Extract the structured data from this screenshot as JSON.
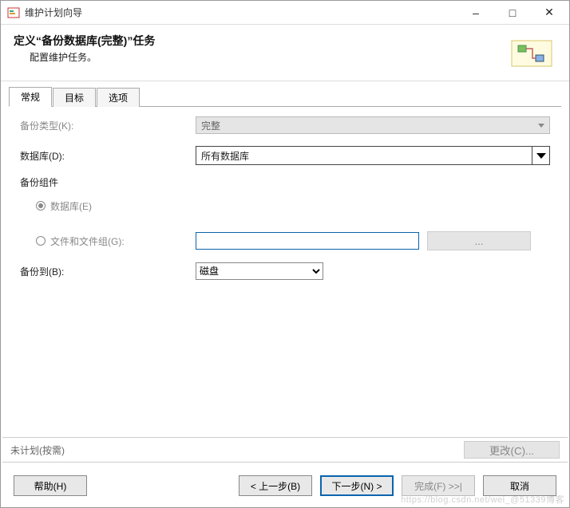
{
  "window": {
    "title": "维护计划向导"
  },
  "header": {
    "title": "定义“备份数据库(完整)”任务",
    "subtitle": "配置维护任务。"
  },
  "tabs": [
    {
      "label": "常规",
      "active": true
    },
    {
      "label": "目标",
      "active": false
    },
    {
      "label": "选项",
      "active": false
    }
  ],
  "form": {
    "backup_type_label": "备份类型(K):",
    "backup_type_value": "完整",
    "database_label": "数据库(D):",
    "database_value": "所有数据库",
    "component_label": "备份组件",
    "radio_database_label": "数据库(E)",
    "radio_filegroup_label": "文件和文件组(G):",
    "filegroup_value": "",
    "ellipsis_label": "...",
    "backup_to_label": "备份到(B):",
    "backup_to_value": "磁盘"
  },
  "bottom": {
    "schedule_text": "未计划(按需)",
    "change_label": "更改(C)..."
  },
  "footer": {
    "help": "帮助(H)",
    "back": "< 上一步(B)",
    "next": "下一步(N) >",
    "finish": "完成(F) >>|",
    "cancel": "取消"
  },
  "watermark": "https://blog.csdn.net/wei_@51339博客"
}
